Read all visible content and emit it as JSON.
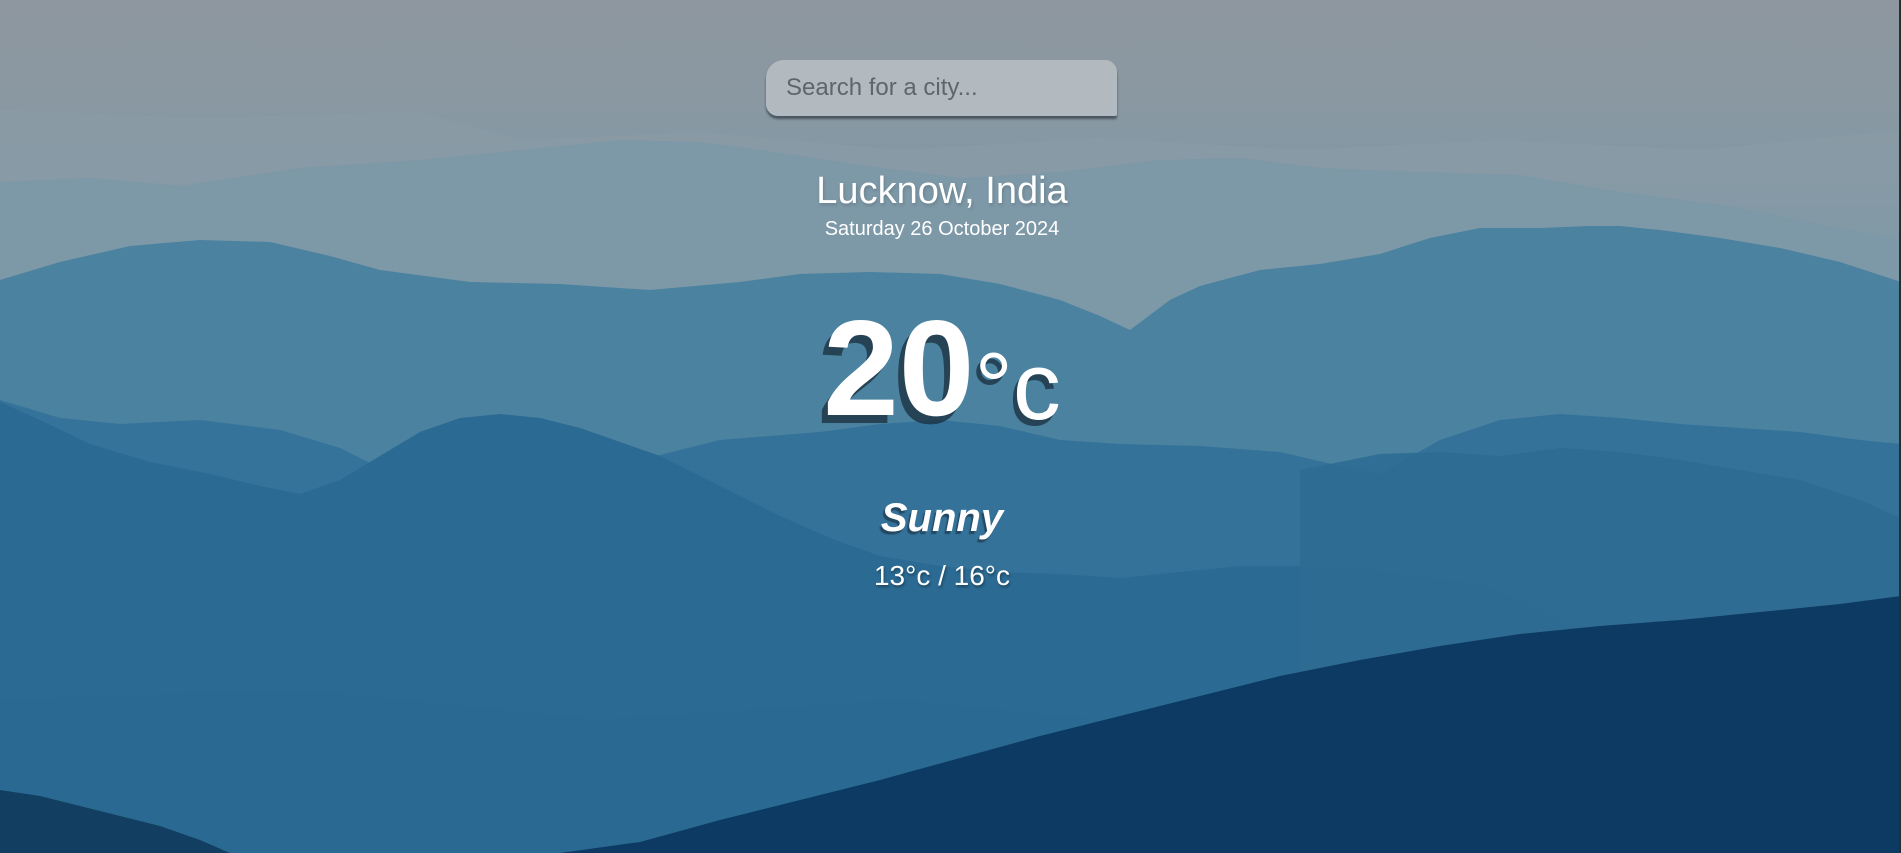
{
  "search": {
    "placeholder": "Search for a city..."
  },
  "weather": {
    "location": "Lucknow, India",
    "date": "Saturday 26 October 2024",
    "temperature": "20",
    "unit": "°c",
    "condition": "Sunny",
    "range": "13°c / 16°c"
  },
  "colors": {
    "text": "#ffffff",
    "sky": "#8e979f",
    "mountain_far": "#7b98aa",
    "mountain_mid": "#46809f",
    "mountain_near": "#2a6a91",
    "mountain_dark": "#0e3a62"
  }
}
